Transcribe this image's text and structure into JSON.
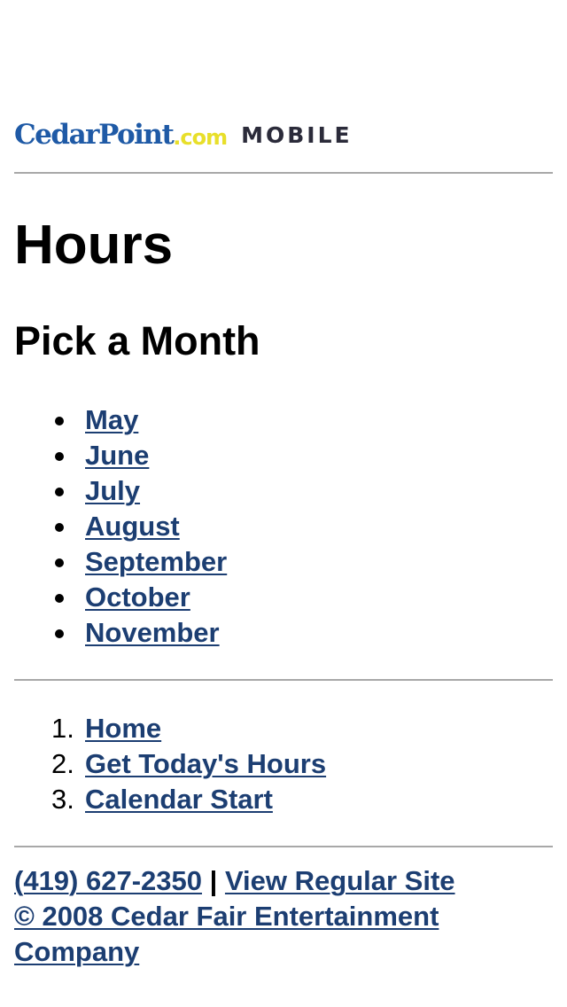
{
  "header": {
    "logo_cedar": "CedarPoint",
    "logo_dotcom": ".com",
    "logo_mobile": "MOBILE"
  },
  "main": {
    "title": "Hours",
    "subtitle": "Pick a Month",
    "months": [
      {
        "label": "May"
      },
      {
        "label": "June"
      },
      {
        "label": "July"
      },
      {
        "label": "August"
      },
      {
        "label": "September"
      },
      {
        "label": "October"
      },
      {
        "label": "November"
      }
    ]
  },
  "nav": {
    "items": [
      {
        "number": "1.",
        "label": "Home"
      },
      {
        "number": "2.",
        "label": "Get Today's Hours"
      },
      {
        "number": "3.",
        "label": "Calendar Start"
      }
    ]
  },
  "footer": {
    "phone": "(419) 627-2350",
    "separator": "|",
    "regular_site": "View Regular Site",
    "copyright": "© 2008 Cedar Fair Entertainment Company"
  },
  "colors": {
    "link": "#1c3e72",
    "logo_blue": "#1f5aa6",
    "logo_yellow": "#e8df2a",
    "rule": "#a8a8a8"
  }
}
